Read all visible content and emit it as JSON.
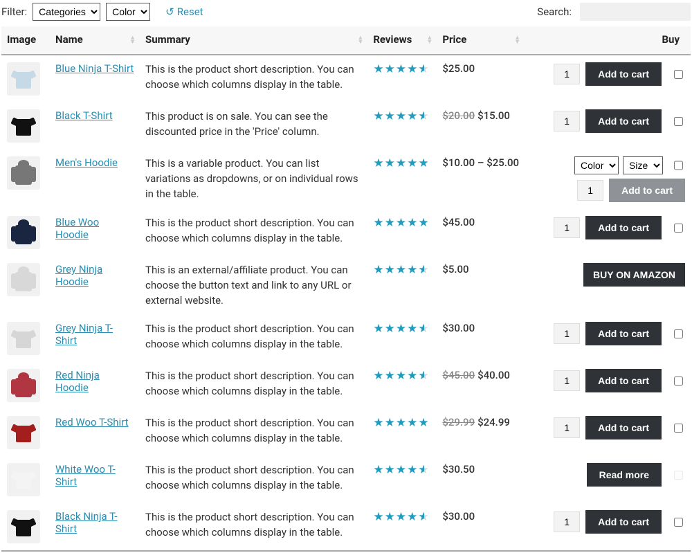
{
  "filter": {
    "label": "Filter:",
    "categories_label": "Categories",
    "color_label": "Color",
    "reset_label": "Reset"
  },
  "search": {
    "label": "Search:",
    "value": ""
  },
  "headers": {
    "image": "Image",
    "name": "Name",
    "summary": "Summary",
    "reviews": "Reviews",
    "price": "Price",
    "buy": "Buy"
  },
  "buttons": {
    "add_to_cart": "Add to cart",
    "read_more": "Read more",
    "buy_amazon": "BUY ON AMAZON"
  },
  "variations": {
    "color": "Color",
    "size": "Size"
  },
  "default_qty": "1",
  "products": [
    {
      "name": "Blue Ninja T-Shirt",
      "summary": "This is the product short description. You can choose which columns display in the table.",
      "rating": 4.5,
      "price": "$25.00",
      "shape": "tshirt",
      "color": "#c6d9e6",
      "buy_type": "cart"
    },
    {
      "name": "Black T-Shirt",
      "summary": "This product is on sale. You can see the discounted price in the 'Price' column.",
      "rating": 4.5,
      "old_price": "$20.00",
      "price": "$15.00",
      "shape": "tshirt",
      "color": "#111",
      "buy_type": "cart"
    },
    {
      "name": "Men's Hoodie",
      "summary": "This is a variable product. You can list variations as dropdowns, or on individual rows in the table.",
      "rating": 5,
      "price": "$10.00 – $25.00",
      "shape": "hoodie",
      "color": "#777",
      "buy_type": "variable"
    },
    {
      "name": "Blue Woo Hoodie",
      "summary": "This is the product short description. You can choose which columns display in the table.",
      "rating": 5,
      "price": "$45.00",
      "shape": "hoodie",
      "color": "#1a2542",
      "buy_type": "cart"
    },
    {
      "name": "Grey Ninja Hoodie",
      "summary": "This is an external/affiliate product. You can choose the button text and link to any URL or external website.",
      "rating": 4.5,
      "price": "$5.00",
      "shape": "hoodie",
      "color": "#d8d8d8",
      "buy_type": "external"
    },
    {
      "name": "Grey Ninja T-Shirt",
      "summary": "This is the product short description. You can choose which columns display in the table.",
      "rating": 4.5,
      "price": "$30.00",
      "shape": "tshirt",
      "color": "#d6d6d6",
      "buy_type": "cart"
    },
    {
      "name": "Red Ninja Hoodie",
      "summary": "This is the product short description. You can choose which columns display in the table.",
      "rating": 4.5,
      "old_price": "$45.00",
      "price": "$40.00",
      "shape": "hoodie",
      "color": "#b03742",
      "buy_type": "cart"
    },
    {
      "name": "Red Woo T-Shirt",
      "summary": "This is the product short description. You can choose which columns display in the table.",
      "rating": 5,
      "old_price": "$29.99",
      "price": "$24.99",
      "shape": "tshirt",
      "color": "#a51e1e",
      "buy_type": "cart"
    },
    {
      "name": "White Woo T-Shirt",
      "summary": "This is the product short description. You can choose which columns display in the table.",
      "rating": 4.5,
      "price": "$30.50",
      "shape": "tshirt",
      "color": "#f4f4f4",
      "buy_type": "readmore"
    },
    {
      "name": "Black Ninja T-Shirt",
      "summary": "This is the product short description. You can choose which columns display in the table.",
      "rating": 4.5,
      "price": "$30.00",
      "shape": "tshirt",
      "color": "#111",
      "buy_type": "cart"
    }
  ]
}
